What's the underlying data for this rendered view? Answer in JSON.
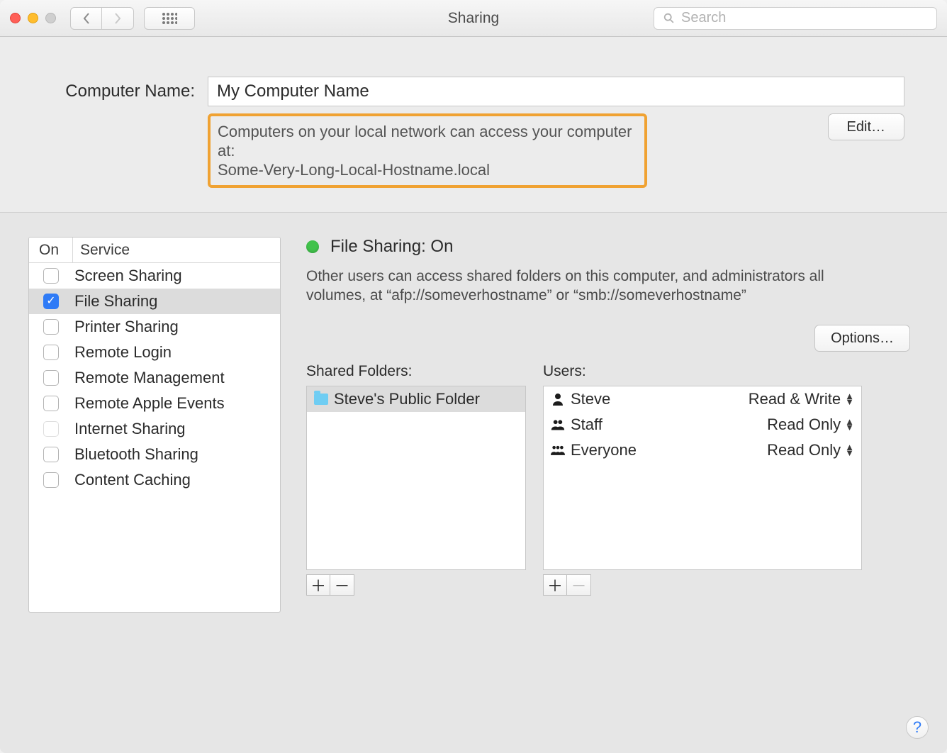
{
  "window": {
    "title": "Sharing"
  },
  "search": {
    "placeholder": "Search"
  },
  "computer_name": {
    "label": "Computer Name:",
    "value": "My Computer Name",
    "hint_line1": "Computers on your local network can access your computer at:",
    "hint_line2": "Some-Very-Long-Local-Hostname.local",
    "edit_label": "Edit…"
  },
  "services": {
    "header_on": "On",
    "header_service": "Service",
    "items": [
      {
        "label": "Screen Sharing",
        "checked": false,
        "enabled": true,
        "selected": false
      },
      {
        "label": "File Sharing",
        "checked": true,
        "enabled": true,
        "selected": true
      },
      {
        "label": "Printer Sharing",
        "checked": false,
        "enabled": true,
        "selected": false
      },
      {
        "label": "Remote Login",
        "checked": false,
        "enabled": true,
        "selected": false
      },
      {
        "label": "Remote Management",
        "checked": false,
        "enabled": true,
        "selected": false
      },
      {
        "label": "Remote Apple Events",
        "checked": false,
        "enabled": true,
        "selected": false
      },
      {
        "label": "Internet Sharing",
        "checked": false,
        "enabled": false,
        "selected": false
      },
      {
        "label": "Bluetooth Sharing",
        "checked": false,
        "enabled": true,
        "selected": false
      },
      {
        "label": "Content Caching",
        "checked": false,
        "enabled": true,
        "selected": false
      }
    ]
  },
  "detail": {
    "status_label": "File Sharing: On",
    "description": "Other users can access shared folders on this computer, and administrators all volumes, at “afp://someverhostname” or “smb://someverhostname”",
    "options_label": "Options…",
    "shared_folders_label": "Shared Folders:",
    "users_label": "Users:",
    "shared_folders": [
      {
        "name": "Steve's Public Folder",
        "selected": true
      }
    ],
    "users": [
      {
        "name": "Steve",
        "icon": "single",
        "permission": "Read & Write"
      },
      {
        "name": "Staff",
        "icon": "double",
        "permission": "Read Only"
      },
      {
        "name": "Everyone",
        "icon": "triple",
        "permission": "Read Only"
      }
    ]
  }
}
